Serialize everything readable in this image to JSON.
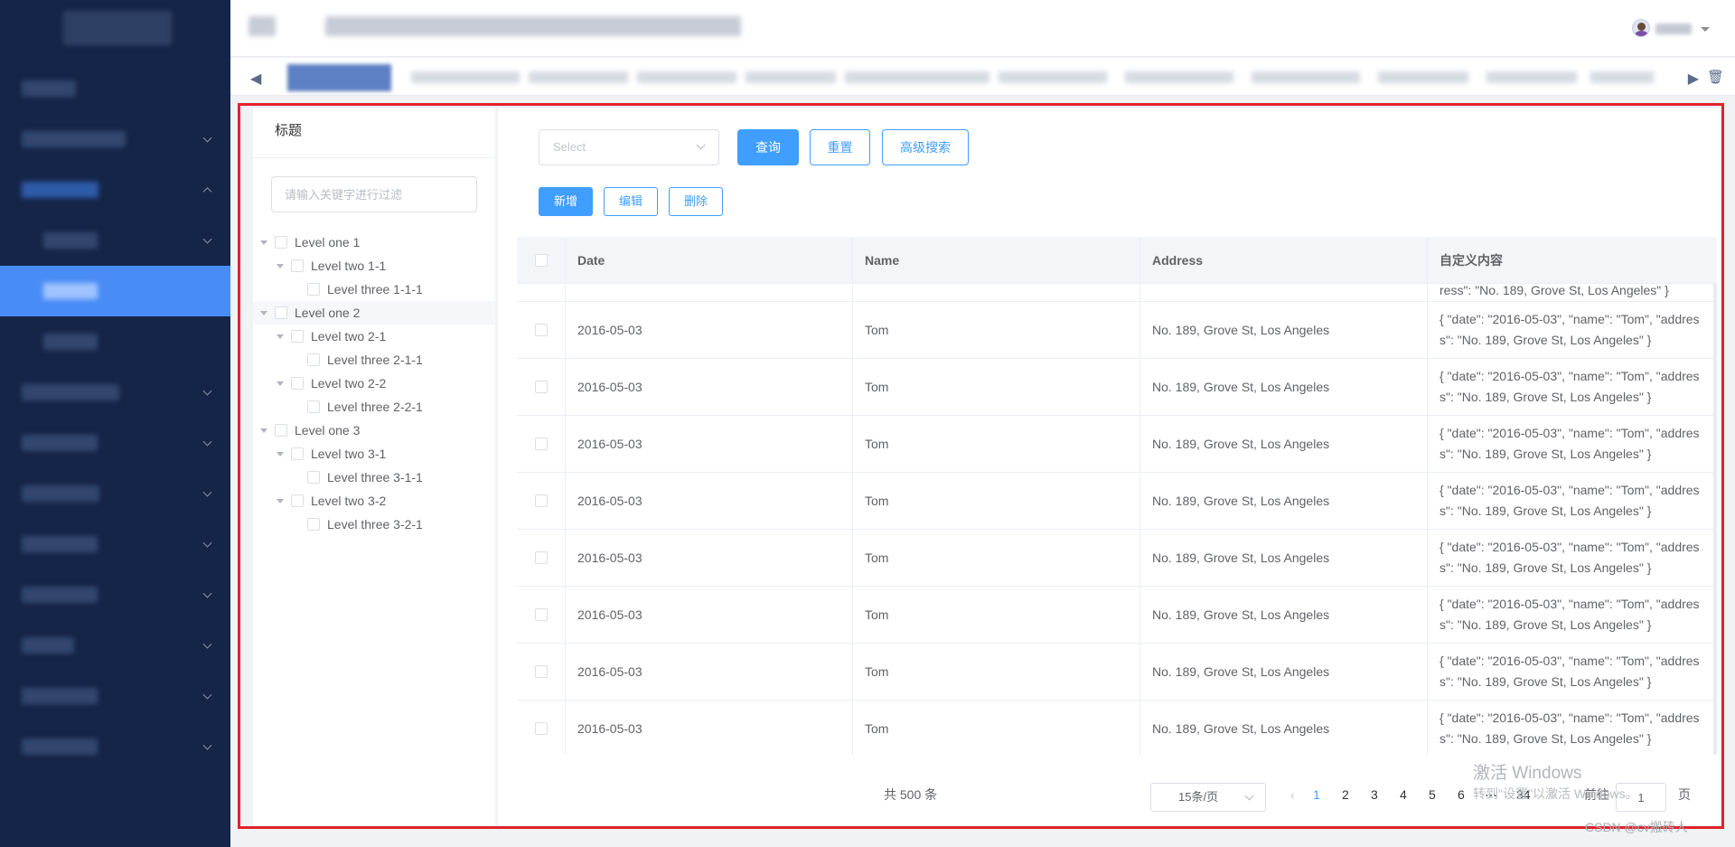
{
  "tree_panel": {
    "title": "标题",
    "filter_placeholder": "请输入关键字进行过滤",
    "nodes": [
      {
        "label": "Level one 1",
        "level": 1
      },
      {
        "label": "Level two 1-1",
        "level": 2
      },
      {
        "label": "Level three 1-1-1",
        "level": 3
      },
      {
        "label": "Level one 2",
        "level": 1
      },
      {
        "label": "Level two 2-1",
        "level": 2
      },
      {
        "label": "Level three 2-1-1",
        "level": 3
      },
      {
        "label": "Level two 2-2",
        "level": 2
      },
      {
        "label": "Level three 2-2-1",
        "level": 3
      },
      {
        "label": "Level one 3",
        "level": 1
      },
      {
        "label": "Level two 3-1",
        "level": 2
      },
      {
        "label": "Level three 3-1-1",
        "level": 3
      },
      {
        "label": "Level two 3-2",
        "level": 2
      },
      {
        "label": "Level three 3-2-1",
        "level": 3
      }
    ]
  },
  "search": {
    "select_placeholder": "Select",
    "query_label": "查询",
    "reset_label": "重置",
    "advanced_label": "高级搜索"
  },
  "toolbar": {
    "add_label": "新增",
    "edit_label": "编辑",
    "delete_label": "删除"
  },
  "table": {
    "columns": [
      "Date",
      "Name",
      "Address",
      "自定义内容"
    ],
    "partial_row_text": "ress\": \"No. 189, Grove St, Los Angeles\" }",
    "rows": [
      {
        "date": "2016-05-03",
        "name": "Tom",
        "address": "No. 189, Grove St, Los Angeles",
        "custom": "{ \"date\": \"2016-05-03\", \"name\": \"Tom\", \"address\": \"No. 189, Grove St, Los Angeles\" }"
      },
      {
        "date": "2016-05-03",
        "name": "Tom",
        "address": "No. 189, Grove St, Los Angeles",
        "custom": "{ \"date\": \"2016-05-03\", \"name\": \"Tom\", \"address\": \"No. 189, Grove St, Los Angeles\" }"
      },
      {
        "date": "2016-05-03",
        "name": "Tom",
        "address": "No. 189, Grove St, Los Angeles",
        "custom": "{ \"date\": \"2016-05-03\", \"name\": \"Tom\", \"address\": \"No. 189, Grove St, Los Angeles\" }"
      },
      {
        "date": "2016-05-03",
        "name": "Tom",
        "address": "No. 189, Grove St, Los Angeles",
        "custom": "{ \"date\": \"2016-05-03\", \"name\": \"Tom\", \"address\": \"No. 189, Grove St, Los Angeles\" }"
      },
      {
        "date": "2016-05-03",
        "name": "Tom",
        "address": "No. 189, Grove St, Los Angeles",
        "custom": "{ \"date\": \"2016-05-03\", \"name\": \"Tom\", \"address\": \"No. 189, Grove St, Los Angeles\" }"
      },
      {
        "date": "2016-05-03",
        "name": "Tom",
        "address": "No. 189, Grove St, Los Angeles",
        "custom": "{ \"date\": \"2016-05-03\", \"name\": \"Tom\", \"address\": \"No. 189, Grove St, Los Angeles\" }"
      },
      {
        "date": "2016-05-03",
        "name": "Tom",
        "address": "No. 189, Grove St, Los Angeles",
        "custom": "{ \"date\": \"2016-05-03\", \"name\": \"Tom\", \"address\": \"No. 189, Grove St, Los Angeles\" }"
      },
      {
        "date": "2016-05-03",
        "name": "Tom",
        "address": "No. 189, Grove St, Los Angeles",
        "custom": "{ \"date\": \"2016-05-03\", \"name\": \"Tom\", \"address\": \"No. 189, Grove St, Los Angeles\" }"
      }
    ]
  },
  "pagination": {
    "total": "共 500 条",
    "page_size": "15条/页",
    "pages": [
      "1",
      "2",
      "3",
      "4",
      "5",
      "6",
      "···",
      "34"
    ],
    "current": "1",
    "goto_prefix": "前往",
    "goto_value": "1",
    "goto_suffix": "页"
  },
  "watermark": {
    "activate_title": "激活 Windows",
    "activate_hint": "转到\"设置\"以激活 Windows。",
    "csdn": "CSDN @cv搬砖人"
  },
  "colors": {
    "sidebar_bg": "#152548",
    "sidebar_active": "#4a8cf5",
    "primary": "#409eff",
    "highlight_border": "#e2222d"
  },
  "icons": {
    "tabs_prev": "double-chevron-left-icon",
    "tabs_next": "double-chevron-right-icon",
    "tabs_close_all": "trash-icon",
    "user_menu": "caret-down-icon"
  }
}
